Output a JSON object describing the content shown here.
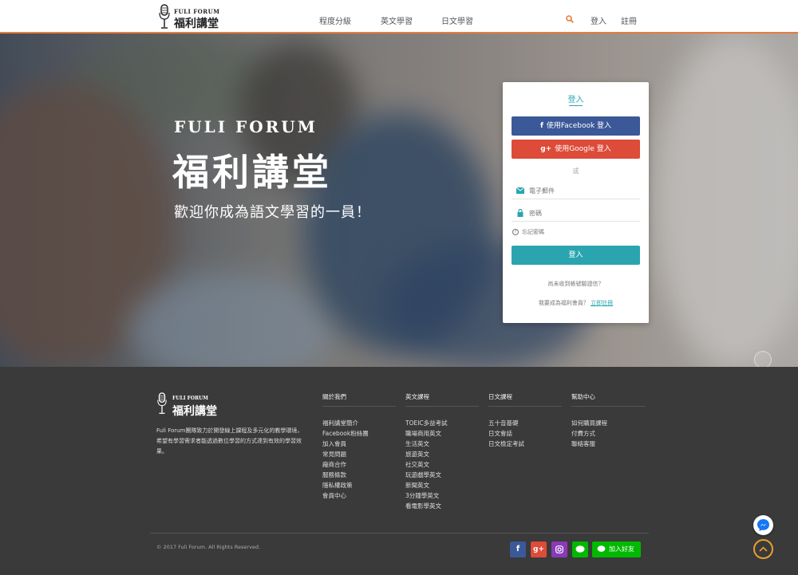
{
  "header": {
    "logo_en": "FULI FORUM",
    "logo_zh": "福利講堂",
    "nav": [
      "程度分級",
      "英文學習",
      "日文學習"
    ],
    "login": "登入",
    "register": "註冊"
  },
  "hero": {
    "title_en": "FULI FORUM",
    "title_zh": "福利講堂",
    "subtitle": "歡迎你成為語文學習的一員！"
  },
  "login_card": {
    "title": "登入",
    "facebook_button": "使用Facebook 登入",
    "google_button": "使用Google 登入",
    "or": "或",
    "email_placeholder": "電子郵件",
    "password_placeholder": "密碼",
    "forgot": "忘記密碼",
    "submit": "登入",
    "resend": "尚未收到帳號驗證信？",
    "join_text": "我要成為福利會員？",
    "join_link": "立即註冊"
  },
  "footer": {
    "logo_en": "FULI FORUM",
    "logo_zh": "福利講堂",
    "description": "Fuli Forum團隊致力於開發線上課程及多元化的教學環境，希望有學習需求者能透過數位學習的方式達到有效的學習效果。",
    "columns": [
      {
        "title": "關於我們",
        "items": [
          "福利講堂簡介",
          "Facebook粉絲團",
          "加入會員",
          "常見問題",
          "廠商合作",
          "服務條款",
          "隱私權政策",
          "會員中心"
        ]
      },
      {
        "title": "英文課程",
        "items": [
          "TOEIC多益考試",
          "職場商用英文",
          "生活英文",
          "旅遊英文",
          "社交英文",
          "玩遊戲學英文",
          "新聞英文",
          "3分鐘學英文",
          "看電影學英文"
        ]
      },
      {
        "title": "日文課程",
        "items": [
          "五十音基礎",
          "日文會話",
          "日文檢定考試"
        ]
      },
      {
        "title": "幫助中心",
        "items": [
          "如何購買課程",
          "付費方式",
          "聯絡客服"
        ]
      }
    ],
    "copyright": "© 2017 Fuli Forum. All Rights Reserved.",
    "line_add": "加入好友"
  },
  "colors": {
    "accent": "#e87c3e",
    "teal": "#2aa5b0",
    "facebook": "#3b5998",
    "google": "#dd4b39",
    "line": "#00b900"
  }
}
